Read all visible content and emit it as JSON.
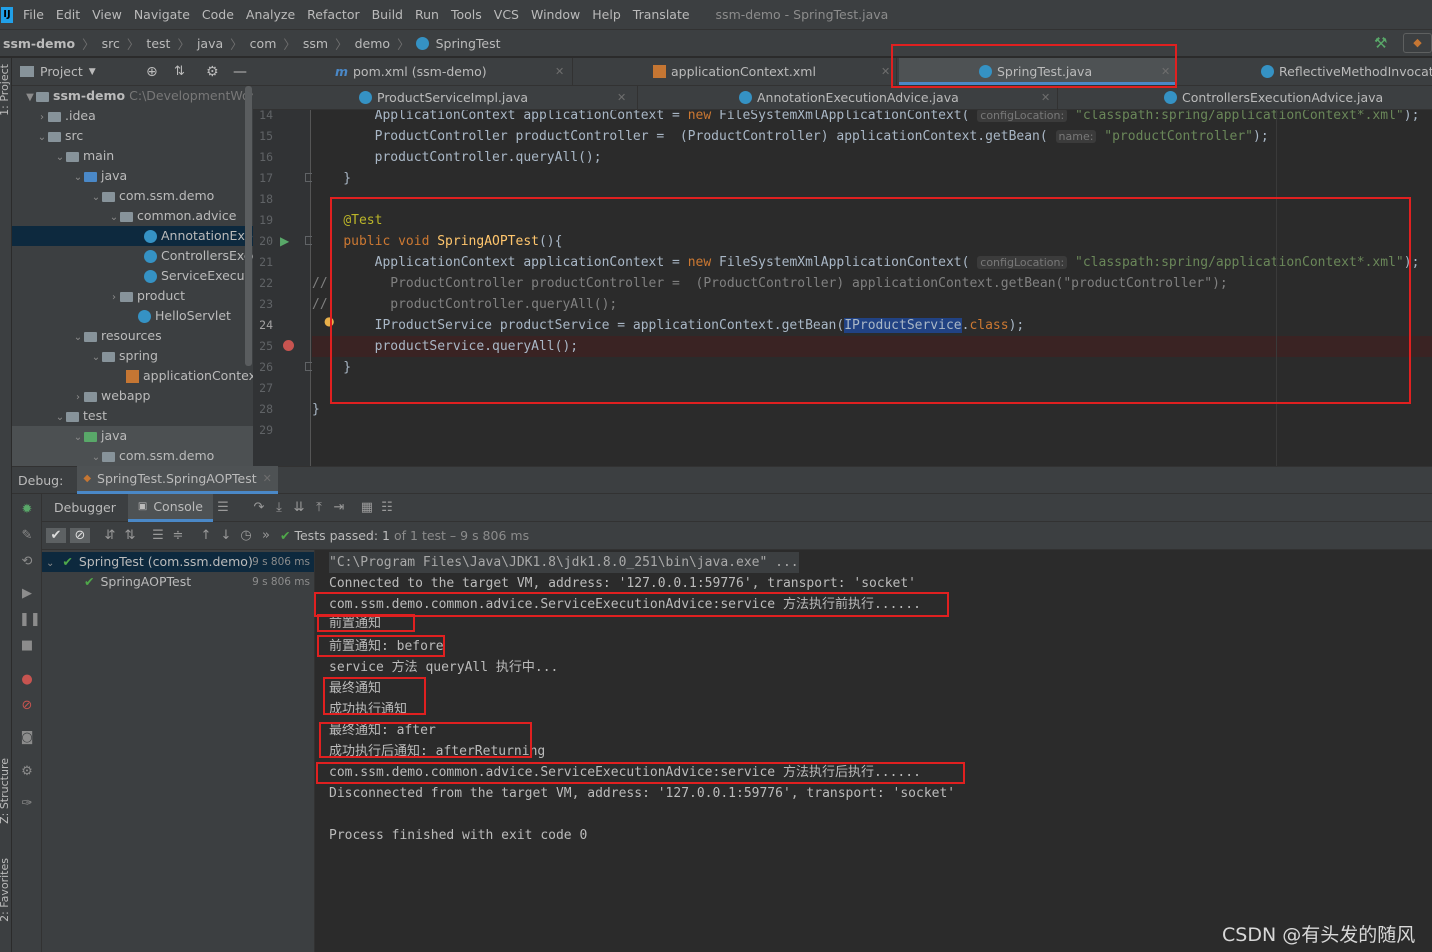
{
  "app": {
    "logo": "IJ",
    "menu": [
      "File",
      "Edit",
      "View",
      "Navigate",
      "Code",
      "Analyze",
      "Refactor",
      "Build",
      "Run",
      "Tools",
      "VCS",
      "Window",
      "Help",
      "Translate"
    ],
    "window_title": "ssm-demo - SpringTest.java"
  },
  "breadcrumb": [
    "ssm-demo",
    "src",
    "test",
    "java",
    "com",
    "ssm",
    "demo",
    "SpringTest"
  ],
  "project_panel": {
    "title": "Project",
    "tree": [
      {
        "label": "ssm-demo",
        "extra": "C:\\DevelopmentWork",
        "type": "module"
      },
      {
        "label": ".idea",
        "type": "folder"
      },
      {
        "label": "src",
        "type": "folder"
      },
      {
        "label": "main",
        "type": "folder"
      },
      {
        "label": "java",
        "type": "srcfolder"
      },
      {
        "label": "com.ssm.demo",
        "type": "package"
      },
      {
        "label": "common.advice",
        "type": "package"
      },
      {
        "label": "AnnotationExec",
        "type": "class"
      },
      {
        "label": "ControllersExec",
        "type": "class"
      },
      {
        "label": "ServiceExecutio",
        "type": "class"
      },
      {
        "label": "product",
        "type": "package"
      },
      {
        "label": "HelloServlet",
        "type": "class"
      },
      {
        "label": "resources",
        "type": "folder"
      },
      {
        "label": "spring",
        "type": "folder"
      },
      {
        "label": "applicationContext",
        "type": "xml"
      },
      {
        "label": "webapp",
        "type": "folder"
      },
      {
        "label": "test",
        "type": "folder"
      },
      {
        "label": "java",
        "type": "srcfolder"
      },
      {
        "label": "com.ssm.demo",
        "type": "package"
      }
    ]
  },
  "editor_tabs_row1": [
    {
      "label": "pom.xml (ssm-demo)"
    },
    {
      "label": "applicationContext.xml"
    },
    {
      "label": "SpringTest.java",
      "active": true
    },
    {
      "label": "ReflectiveMethodInvocatio"
    }
  ],
  "editor_tabs_row2": [
    {
      "label": "ProductServiceImpl.java"
    },
    {
      "label": "AnnotationExecutionAdvice.java"
    },
    {
      "label": "ControllersExecutionAdvice.java"
    }
  ],
  "code": {
    "line_numbers": [
      "14",
      "15",
      "16",
      "17",
      "18",
      "19",
      "20",
      "21",
      "22",
      "23",
      "24",
      "25",
      "26",
      "27",
      "28",
      "29"
    ],
    "lines": [
      "        ApplicationContext applicationContext = new FileSystemXmlApplicationContext( configLocation: \"classpath:spring/applicationContext*.xml\");",
      "        ProductController productController =  (ProductController) applicationContext.getBean( name: \"productController\");",
      "        productController.queryAll();",
      "    }",
      "",
      "    @Test",
      "    public void SpringAOPTest(){",
      "        ApplicationContext applicationContext = new FileSystemXmlApplicationContext( configLocation: \"classpath:spring/applicationContext*.xml\");",
      "//        ProductController productController =  (ProductController) applicationContext.getBean(\"productController\");",
      "//        productController.queryAll();",
      "        IProductService productService = applicationContext.getBean(IProductService.class);",
      "        productService.queryAll();",
      "    }",
      "",
      "}",
      ""
    ]
  },
  "debug": {
    "label": "Debug:",
    "session": "SpringTest.SpringAOPTest",
    "tabs": [
      "Debugger",
      "Console"
    ],
    "tests_passed_label": "Tests passed:",
    "tests_passed_count": "1",
    "tests_passed_rest": "of 1 test – 9 s 806 ms"
  },
  "test_tree": [
    {
      "label": "SpringTest (com.ssm.demo)",
      "time": "9 s 806 ms"
    },
    {
      "label": "SpringAOPTest",
      "time": "9 s 806 ms"
    }
  ],
  "console_lines": [
    "\"C:\\Program Files\\Java\\JDK1.8\\jdk1.8.0_251\\bin\\java.exe\" ...",
    "Connected to the target VM, address: '127.0.0.1:59776', transport: 'socket'",
    "com.ssm.demo.common.advice.ServiceExecutionAdvice:service 方法执行前执行......",
    "前置通知",
    "前置通知: before",
    "service 方法 queryAll 执行中...",
    "最终通知",
    "成功执行通知",
    "最终通知: after",
    "成功执行后通知: afterReturning",
    "com.ssm.demo.common.advice.ServiceExecutionAdvice:service 方法执行后执行......",
    "Disconnected from the target VM, address: '127.0.0.1:59776', transport: 'socket'",
    "",
    "Process finished with exit code 0"
  ],
  "side_labels": [
    "1: Project",
    "Z: Structure",
    "2: Favorites"
  ],
  "watermark": "CSDN @有头发的随风",
  "colors": {
    "highlight_box": "#e02020",
    "keyword": "#cc7832",
    "string": "#6a8759",
    "annotation": "#bbb529"
  }
}
